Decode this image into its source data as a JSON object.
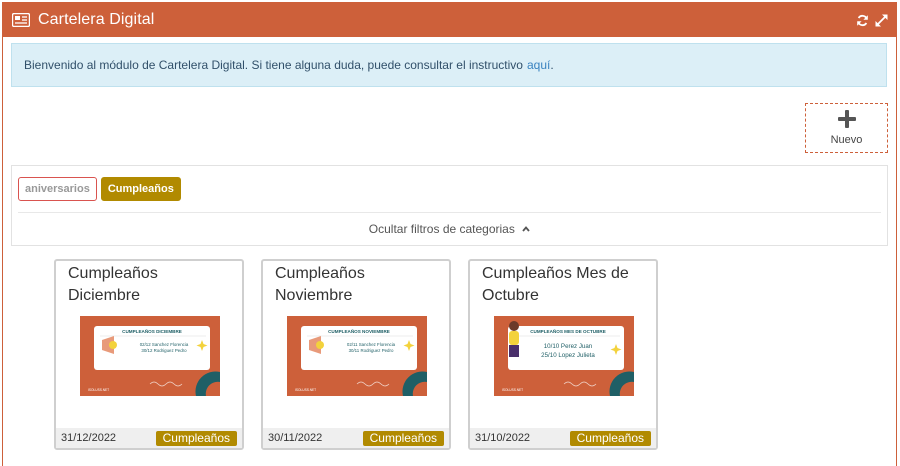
{
  "header": {
    "title": "Cartelera Digital",
    "tools": [
      "refresh-icon",
      "expand-icon"
    ]
  },
  "info": {
    "text": "Bienvenido al módulo de Cartelera Digital. Si tiene alguna duda, puede consultar el instructivo",
    "link_label": "aquí",
    "suffix": "."
  },
  "new_button": {
    "label": "Nuevo"
  },
  "filters": {
    "tags": [
      {
        "label": "aniversarios",
        "active": false
      },
      {
        "label": "Cumpleaños",
        "active": true
      }
    ],
    "toggle_label": "Ocultar filtros de categorias"
  },
  "cards": [
    {
      "title": "Cumpleaños Diciembre",
      "date": "31/12/2022",
      "badge": "Cumpleaños",
      "thumb_heading": "CUMPLEAÑOS DICIEMBRE",
      "thumb_lines": [
        "02/12 Sanchez Florencia",
        "30/12 Rodriguez Pedro"
      ],
      "thumb_brand": "ISOLUSS.NET"
    },
    {
      "title": "Cumpleaños Noviembre",
      "date": "30/11/2022",
      "badge": "Cumpleaños",
      "thumb_heading": "CUMPLEAÑOS NOVIEMBRE",
      "thumb_lines": [
        "02/11 Sanchez Florencia",
        "30/11 Rodriguez Pedro"
      ],
      "thumb_brand": "ISOLUSS.NET"
    },
    {
      "title": "Cumpleaños Mes de Octubre",
      "date": "31/10/2022",
      "badge": "Cumpleaños",
      "thumb_heading": "CUMPLEAÑOS MES DE OCTUBRE",
      "thumb_lines": [
        "10/10 Perez Juan",
        "25/10 Lopez Julieta"
      ],
      "thumb_brand": "ISOLUSS.NET"
    }
  ],
  "colors": {
    "brand": "#cd603a",
    "badge": "#b18a00",
    "info_bg": "#dceff7",
    "thumb_teal": "#1f5f66",
    "thumb_yellow": "#f3d23c"
  }
}
